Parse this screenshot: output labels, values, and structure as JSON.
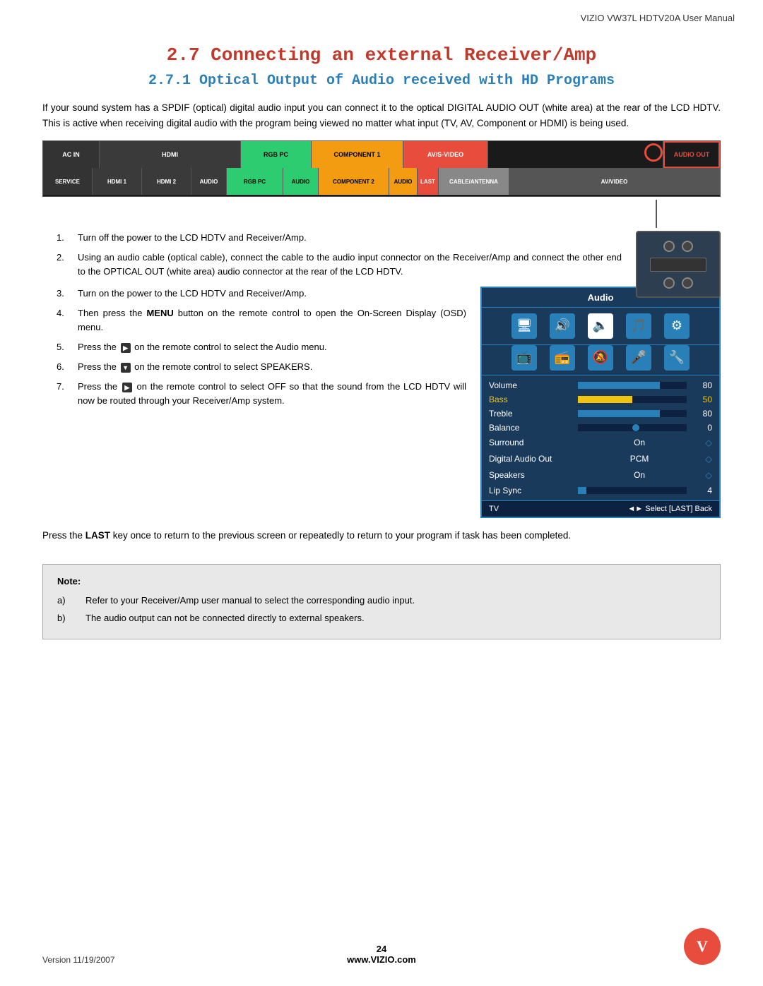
{
  "header": {
    "title": "VIZIO VW37L HDTV20A User Manual"
  },
  "main_title": "2.7  Connecting an external Receiver/Amp",
  "subtitle": "2.7.1 Optical  Output  of  Audio  received  with  HD Programs",
  "intro": "If your sound system has a SPDIF (optical) digital audio input you can connect it to the optical DIGITAL AUDIO OUT (white area) at the rear of the LCD HDTV.  This is active when receiving digital audio with the program being viewed no matter what input (TV, AV, Component or HDMI) is being used.",
  "panel": {
    "sections_top": [
      "AC IN",
      "HDMI",
      "RGB PC",
      "COMPONENT 1",
      "AV/S-VIDEO",
      "AUDIO OUT"
    ],
    "sections_bottom": [
      "SERVICE",
      "HDMI 1",
      "HDMI 2",
      "AUDIO",
      "RGB PC",
      "AUDIO",
      "COMPONENT 2",
      "AUDIO",
      "LAST",
      "CABLE/ANTENNA",
      "AV/VIDEO"
    ]
  },
  "steps": [
    {
      "num": "1.",
      "text": "Turn off the power to the LCD HDTV and Receiver/Amp."
    },
    {
      "num": "2.",
      "text": "Using an audio cable (optical cable), connect the cable to the audio input connector on the Receiver/Amp and connect the other end to the OPTICAL OUT (white area) audio connector at the rear of the LCD HDTV."
    },
    {
      "num": "3.",
      "text": "Turn on the power to the LCD HDTV and Receiver/Amp."
    },
    {
      "num": "4.",
      "text": "Then press the MENU button on the remote control to open the On-Screen Display (OSD) menu.",
      "bold_word": "MENU"
    },
    {
      "num": "5.",
      "text": "Press the ▶ on the remote control to select the Audio menu."
    },
    {
      "num": "6.",
      "text": "Press the ▼ on the remote control to select SPEAKERS."
    },
    {
      "num": "7.",
      "text": "Press the ▶ on the remote control to select OFF so that the sound from the LCD HDTV will now be routed through your Receiver/Amp system."
    }
  ],
  "audio_menu": {
    "header": "Audio",
    "rows": [
      {
        "label": "Volume",
        "type": "bar",
        "fill": 0.75,
        "value": "80",
        "color": "blue"
      },
      {
        "label": "Bass",
        "type": "bar",
        "fill": 0.5,
        "value": "50",
        "color": "yellow"
      },
      {
        "label": "Treble",
        "type": "bar",
        "fill": 0.75,
        "value": "80",
        "color": "blue"
      },
      {
        "label": "Balance",
        "type": "dot",
        "value": "0",
        "color": "blue"
      },
      {
        "label": "Surround",
        "type": "text",
        "value": "On",
        "icon": true
      },
      {
        "label": "Digital Audio Out",
        "type": "text",
        "value": "PCM",
        "icon": true
      },
      {
        "label": "Speakers",
        "type": "text",
        "value": "On",
        "icon": true
      },
      {
        "label": "Lip Sync",
        "type": "bar",
        "fill": 0.08,
        "value": "4",
        "color": "blue"
      }
    ],
    "footer_left": "TV",
    "footer_right": "◄► Select  [LAST] Back"
  },
  "last_paragraph": "Press the LAST key once to return to the previous screen or repeatedly to return to your program if task has been completed.",
  "note": {
    "title": "Note:",
    "items": [
      {
        "label": "a)",
        "text": "Refer to your Receiver/Amp user manual to select the corresponding audio input."
      },
      {
        "label": "b)",
        "text": "The audio output can not be connected directly to external speakers."
      }
    ]
  },
  "footer": {
    "version": "Version 11/19/2007",
    "page": "24",
    "website": "www.VIZIO.com",
    "logo": "V"
  }
}
